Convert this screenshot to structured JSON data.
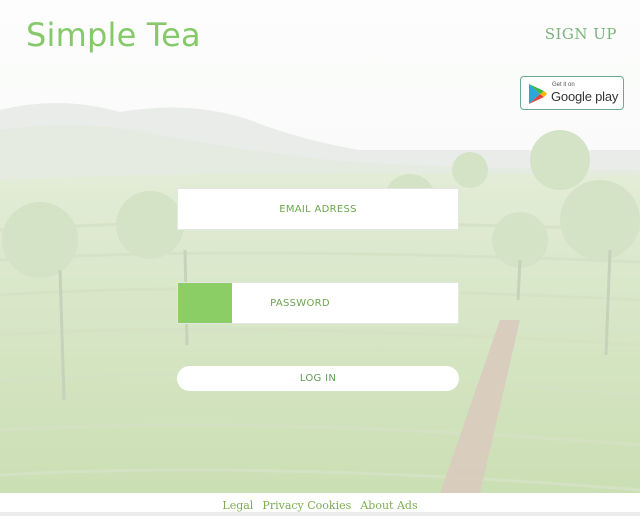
{
  "header": {
    "brand": "Simple Tea",
    "signup_label": "SIGN UP"
  },
  "store_badge": {
    "small_text": "Get it on",
    "big_text": "Google play",
    "icon": "google-play-icon"
  },
  "form": {
    "email_placeholder": "EMAIL ADRESS",
    "password_placeholder": "PASSWORD",
    "login_label": "LOG IN"
  },
  "footer": {
    "links": [
      "Legal",
      "Privacy Cookies",
      "About Ads"
    ]
  },
  "colors": {
    "brand_green": "#86c96a",
    "accent_green": "#8bce65",
    "text_green": "#6aa64e"
  }
}
